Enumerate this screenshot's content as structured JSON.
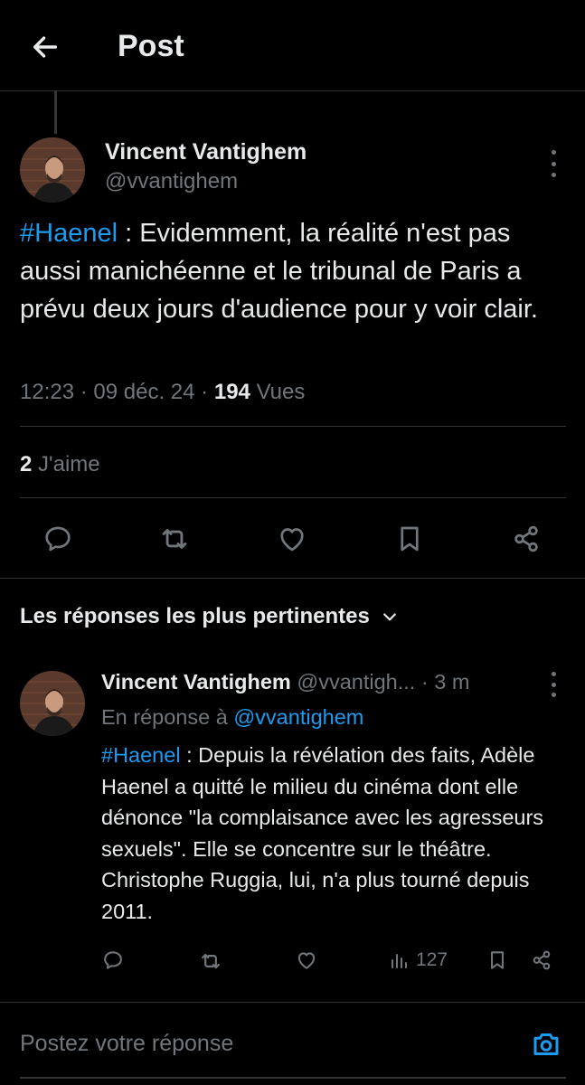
{
  "header": {
    "title": "Post"
  },
  "tweet": {
    "author_name": "Vincent Vantighem",
    "author_handle": "@vvantighem",
    "hashtag": "#Haenel",
    "text": " : Evidemment, la réalité n'est pas aussi manichéenne et le tribunal de Paris a prévu deux jours d'audience pour y voir clair.",
    "time": "12:23",
    "date": "09 déc. 24",
    "views_count": "194",
    "views_label": "Vues",
    "likes_count": "2",
    "likes_label": "J'aime"
  },
  "replies": {
    "section_title": "Les réponses les plus pertinentes",
    "items": [
      {
        "author_name": "Vincent Vantighem",
        "author_handle": "@vvantigh...",
        "time_ago": "3 m",
        "in_reply_prefix": "En réponse à",
        "in_reply_handle": "@vvantighem",
        "hashtag": "#Haenel",
        "text": " : Depuis la révélation des faits, Adèle Haenel a quitté le milieu du cinéma dont elle dénonce \"la complaisance avec les agresseurs sexuels\". Elle se concentre sur le théâtre. Christophe Ruggia, lui, n'a plus tourné depuis 2011.",
        "views": "127"
      }
    ]
  },
  "composer": {
    "placeholder": "Postez votre réponse"
  },
  "colors": {
    "accent": "#1d9bf0",
    "muted": "#71767b",
    "text": "#e7e9ea",
    "background": "#000000",
    "divider": "#2f3336"
  },
  "icons": {
    "back": "arrow-left-icon",
    "more": "more-vertical-icon",
    "reply": "reply-bubble-icon",
    "repost": "repost-icon",
    "like": "heart-icon",
    "bookmark": "bookmark-icon",
    "share": "share-icon",
    "views": "views-bars-icon",
    "chevron": "chevron-down-icon",
    "camera": "camera-icon"
  }
}
